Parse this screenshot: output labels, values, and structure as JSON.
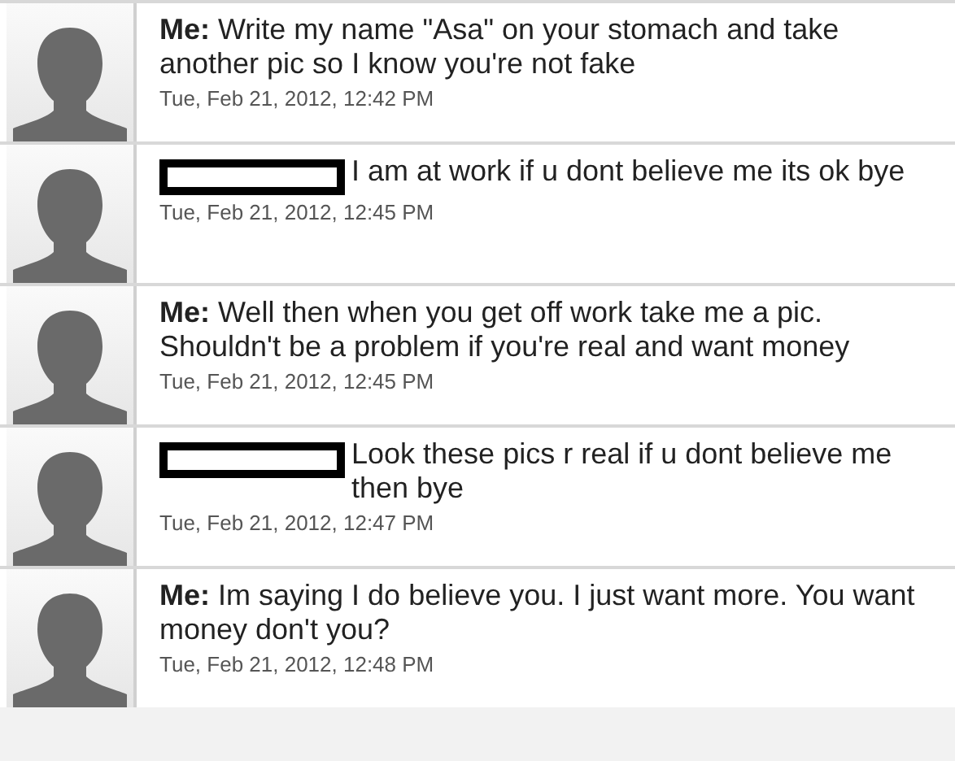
{
  "messages": [
    {
      "kind": "sent",
      "sender": "Me:",
      "text": "Write my name \"Asa\" on your stomach and take another pic so I know you're not fake",
      "time": "Tue, Feb 21, 2012, 12:42 PM"
    },
    {
      "kind": "received",
      "text": "I am at work if u dont believe me its ok bye",
      "time": "Tue, Feb 21, 2012, 12:45 PM"
    },
    {
      "kind": "sent",
      "sender": "Me:",
      "text": "Well then when you get off work take me a pic. Shouldn't be a problem if you're real and want money",
      "time": "Tue, Feb 21, 2012, 12:45 PM"
    },
    {
      "kind": "received",
      "text": "Look these pics r real if u dont believe me then bye",
      "time": "Tue, Feb 21, 2012, 12:47 PM"
    },
    {
      "kind": "sent",
      "sender": "Me:",
      "text": "Im saying I do believe you. I just want more. You want money don't you?",
      "time": "Tue, Feb 21, 2012, 12:48 PM"
    }
  ]
}
